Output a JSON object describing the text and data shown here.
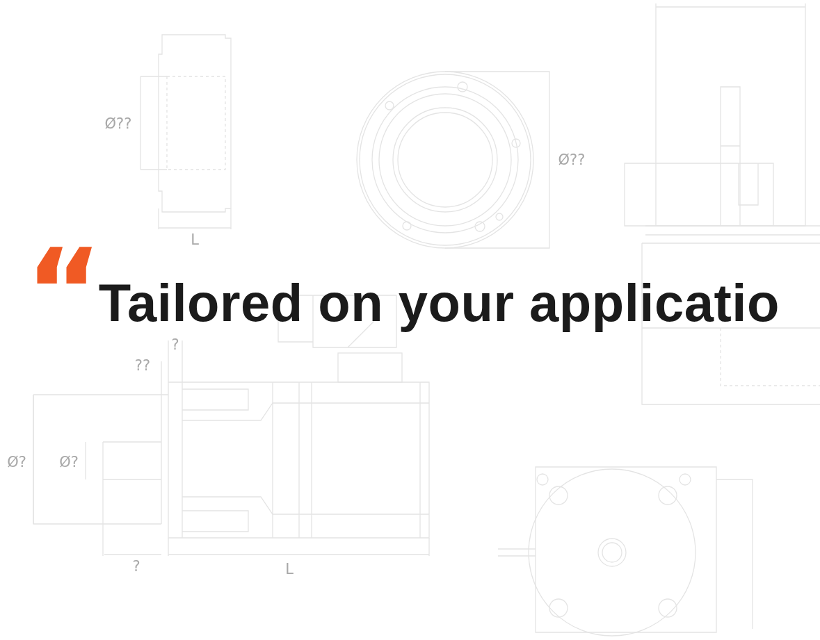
{
  "hero": {
    "quote_mark": "“",
    "headline": "Tailored on your applicatio"
  },
  "drawing_labels": [
    {
      "text": "Ø??"
    },
    {
      "text": "Ø??"
    },
    {
      "text": "L"
    },
    {
      "text": "?"
    },
    {
      "text": "??"
    },
    {
      "text": "Ø?"
    },
    {
      "text": "Ø?"
    },
    {
      "text": "?"
    },
    {
      "text": "L"
    }
  ]
}
